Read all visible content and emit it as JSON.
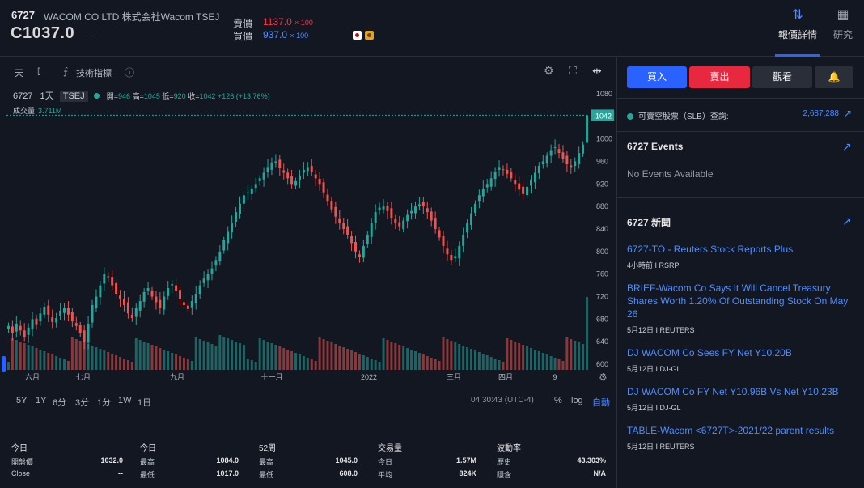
{
  "header": {
    "symbol": "6727",
    "company": "WACOM CO LTD 株式会社Wacom  TSEJ",
    "price": "C1037.0",
    "price_dash": "– –",
    "ask_label": "賣價",
    "ask_price": "1137.0",
    "ask_size": "× 100",
    "bid_label": "買價",
    "bid_price": "937.0",
    "bid_size": "× 100",
    "tabs": [
      {
        "label": "報價詳情",
        "icon": "sort-arrows-icon",
        "active": true
      },
      {
        "label": "研究",
        "icon": "building-icon",
        "active": false
      }
    ]
  },
  "chart_toolbar": {
    "interval": "天",
    "indicators": "技術指標"
  },
  "legend": {
    "symbol": "6727",
    "interval": "1天",
    "exchange": "TSEJ",
    "open_label": "開=",
    "open": "946",
    "high_label": "高=",
    "high": "1045",
    "low_label": "低=",
    "low": "920",
    "close_label": "收=",
    "close": "1042",
    "change": "+126 (+13.76%)",
    "volume_label": "成交量",
    "volume": "3.711M"
  },
  "chart_data": {
    "type": "bar",
    "title": "",
    "price_axis": [
      1080,
      1040,
      1000,
      960,
      920,
      880,
      840,
      800,
      760,
      720,
      680,
      640,
      600
    ],
    "last_price_label": "1042",
    "x_tick_labels": [
      "六月",
      "七月",
      "九月",
      "十一月",
      "2022",
      "三月",
      "四月",
      "9"
    ],
    "ylim": [
      590,
      1090
    ],
    "close_series": [
      668,
      655,
      672,
      660,
      648,
      665,
      680,
      671,
      690,
      702,
      688,
      675,
      682,
      695,
      700,
      688,
      676,
      668,
      655,
      640,
      672,
      705,
      720,
      740,
      760,
      755,
      740,
      725,
      715,
      705,
      690,
      682,
      700,
      712,
      728,
      735,
      720,
      710,
      700,
      720,
      735,
      742,
      730,
      715,
      705,
      698,
      712,
      725,
      740,
      752,
      760,
      770,
      785,
      800,
      820,
      835,
      850,
      870,
      885,
      900,
      905,
      912,
      920,
      930,
      940,
      950,
      958,
      960,
      948,
      940,
      930,
      920,
      925,
      935,
      945,
      950,
      942,
      930,
      920,
      905,
      890,
      875,
      862,
      850,
      840,
      830,
      815,
      800,
      790,
      810,
      830,
      850,
      870,
      878,
      880,
      872,
      860,
      850,
      845,
      855,
      865,
      872,
      880,
      884,
      880,
      870,
      855,
      840,
      825,
      810,
      795,
      785,
      792,
      810,
      830,
      850,
      868,
      885,
      900,
      912,
      920,
      930,
      942,
      950,
      945,
      938,
      930,
      920,
      910,
      902,
      915,
      928,
      940,
      952,
      960,
      970,
      980,
      985,
      975,
      965,
      955,
      950,
      960,
      975,
      990,
      1042
    ]
  },
  "bottom_toolbar": {
    "ranges": [
      "5Y",
      "1Y",
      "6分",
      "3分",
      "1分",
      "1W",
      "1日"
    ],
    "clock": "04:30:43 (UTC-4)",
    "percent": "%",
    "log": "log",
    "auto": "自動"
  },
  "stats": [
    {
      "heading": "今日",
      "rows": [
        {
          "label": "開盤價",
          "value": "1032.0"
        },
        {
          "label": "Close",
          "value": "--"
        }
      ]
    },
    {
      "heading": "今日",
      "rows": [
        {
          "label": "最高",
          "value": "1084.0"
        },
        {
          "label": "最低",
          "value": "1017.0"
        }
      ]
    },
    {
      "heading": "52周",
      "rows": [
        {
          "label": "最高",
          "value": "1045.0"
        },
        {
          "label": "最低",
          "value": "608.0"
        }
      ]
    },
    {
      "heading": "交易量",
      "rows": [
        {
          "label": "今日",
          "value": "1.57M"
        },
        {
          "label": "平均",
          "value": "824K"
        }
      ]
    },
    {
      "heading": "波動率",
      "rows": [
        {
          "label": "歷史",
          "value": "43.303%"
        },
        {
          "label": "隱含",
          "value": "N/A"
        }
      ]
    }
  ],
  "panel": {
    "buy": "買入",
    "sell": "賣出",
    "watch": "觀看",
    "slb_label": "可賣空股票（SLB）查詢:",
    "slb_value": "2,687,288",
    "events_title": "6727 Events",
    "events_empty": "No Events Available",
    "news_title": "6727 新聞",
    "news": [
      {
        "title": "6727-TO - Reuters Stock Reports Plus",
        "meta": "4小時前 I RSRP"
      },
      {
        "title": "BRIEF-Wacom Co Says It Will Cancel Treasury Shares Worth 1.20% Of Outstanding Stock On May 26",
        "meta": "5月12日 I REUTERS"
      },
      {
        "title": "DJ WACOM Co Sees FY Net Y10.20B",
        "meta": "5月12日 I DJ-GL"
      },
      {
        "title": "DJ WACOM Co FY Net Y10.96B Vs Net Y10.23B",
        "meta": "5月12日 I DJ-GL"
      },
      {
        "title": "TABLE-Wacom <6727T>-2021/22 parent results",
        "meta": "5月12日 I REUTERS"
      }
    ]
  },
  "colors": {
    "up": "#26a69a",
    "down": "#ef5350",
    "accent": "#2962ff"
  }
}
